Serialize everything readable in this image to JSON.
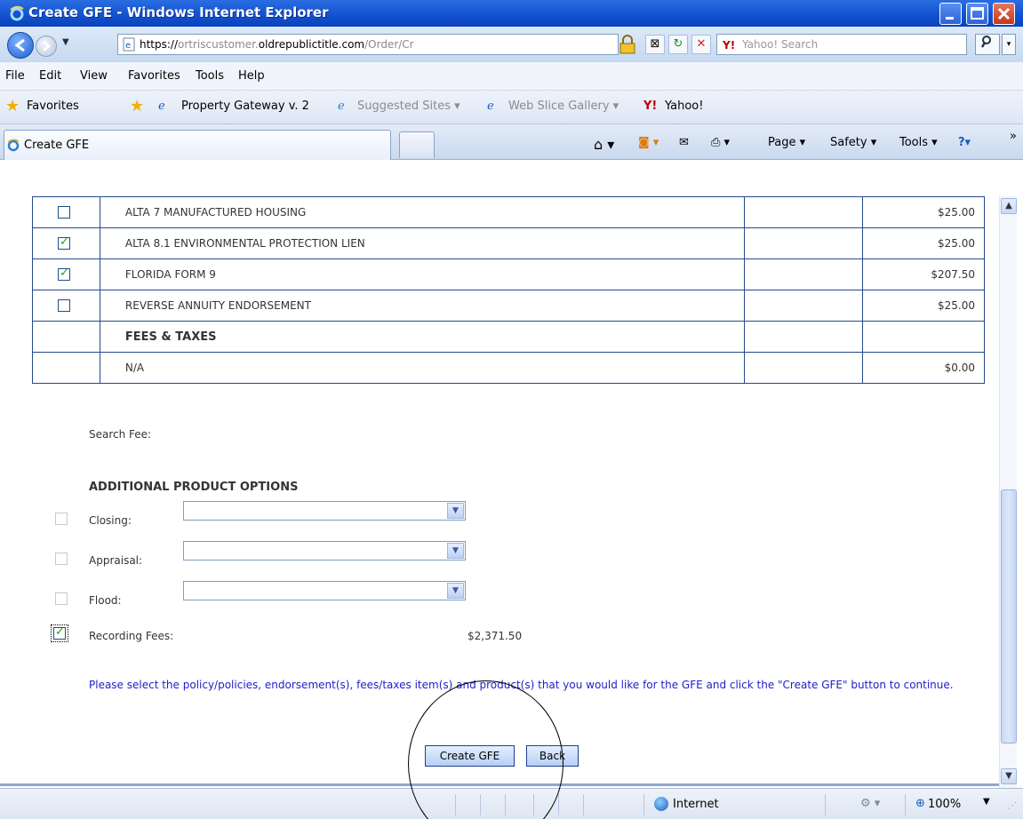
{
  "window": {
    "title": "Create GFE - Windows Internet Explorer"
  },
  "address_bar": {
    "url_proto": "https://",
    "url_sub": "ortriscustomer.",
    "url_host": "oldrepublictitle.com",
    "url_path": "/Order/Cr",
    "search_placeholder": "Yahoo! Search"
  },
  "menu": {
    "items": [
      "File",
      "Edit",
      "View",
      "Favorites",
      "Tools",
      "Help"
    ]
  },
  "favorites_bar": {
    "favorites_label": "Favorites",
    "items": [
      "Property Gateway v. 2",
      "Suggested Sites ▾",
      "Web Slice Gallery ▾",
      "Yahoo!"
    ]
  },
  "tabs": {
    "active": "Create GFE"
  },
  "command_bar": {
    "page": "Page",
    "safety": "Safety",
    "tools": "Tools"
  },
  "endorsements": [
    {
      "label": "ALTA 7 MANUFACTURED HOUSING",
      "checked": false,
      "price": "$25.00"
    },
    {
      "label": "ALTA 8.1 ENVIRONMENTAL PROTECTION LIEN",
      "checked": true,
      "price": "$25.00"
    },
    {
      "label": "FLORIDA FORM 9",
      "checked": true,
      "price": "$207.50"
    },
    {
      "label": "REVERSE ANNUITY ENDORSEMENT",
      "checked": false,
      "price": "$25.00"
    }
  ],
  "fees_taxes": {
    "header": "FEES & TAXES",
    "row_label": "N/A",
    "row_price": "$0.00"
  },
  "search_fee_label": "Search Fee:",
  "additional": {
    "header": "ADDITIONAL PRODUCT OPTIONS",
    "closing_label": "Closing:",
    "appraisal_label": "Appraisal:",
    "flood_label": "Flood:",
    "recording_label": "Recording Fees:",
    "recording_value": "$2,371.50"
  },
  "instructions": "Please select the policy/policies, endorsement(s), fees/taxes item(s) and product(s) that you would like for the GFE and click the \"Create GFE\" button to continue.",
  "buttons": {
    "create": "Create GFE",
    "back": "Back"
  },
  "status_bar": {
    "zone": "Internet",
    "zoom": "100%"
  },
  "colors": {
    "title_bar": "#1150d0",
    "table_border": "#244a8c",
    "instruction_text": "#1e1ec8",
    "check_green": "#21a121"
  }
}
